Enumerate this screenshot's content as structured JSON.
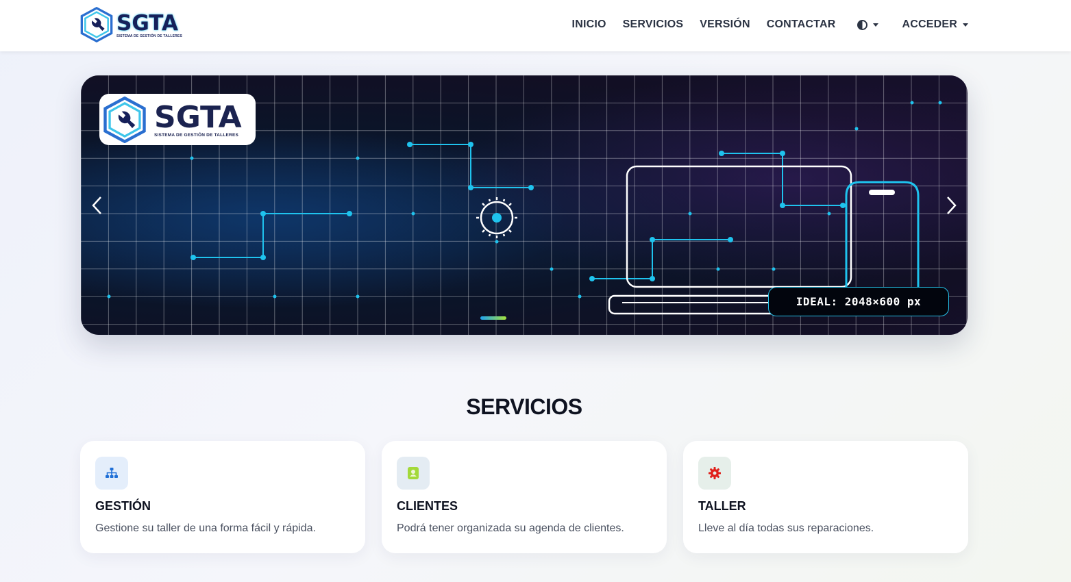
{
  "brand": {
    "name": "SGTA",
    "subtitle": "SISTEMA DE GESTIÓN DE TALLERES"
  },
  "nav": {
    "items": [
      "INICIO",
      "SERVICIOS",
      "VERSIÓN",
      "CONTACTAR"
    ],
    "theme_icon": "contrast-icon",
    "account_label": "ACCEDER"
  },
  "carousel": {
    "badge": "IDEAL: 2048×600 px",
    "prev_icon": "chevron-left-icon",
    "next_icon": "chevron-right-icon",
    "slide_count": 1,
    "active_slide": 1
  },
  "services": {
    "title": "SERVICIOS",
    "cards": [
      {
        "title": "GESTIÓN",
        "text": "Gestione su taller de una forma fácil y rápida.",
        "icon": "sitemap-icon",
        "icon_color": "#1f6fd6",
        "icon_bg": "#e4eefb"
      },
      {
        "title": "CLIENTES",
        "text": "Podrá tener organizada su agenda de clientes.",
        "icon": "contact-book-icon",
        "icon_color": "#a3d93a",
        "icon_bg": "#e4ecf3"
      },
      {
        "title": "TALLER",
        "text": "Lleve al día todas sus reparaciones.",
        "icon": "gear-icon",
        "icon_color": "#e0201a",
        "icon_bg": "#e6efea"
      }
    ]
  },
  "colors": {
    "accent_cyan": "#1fc3ee",
    "brand_navy": "#16205a"
  }
}
